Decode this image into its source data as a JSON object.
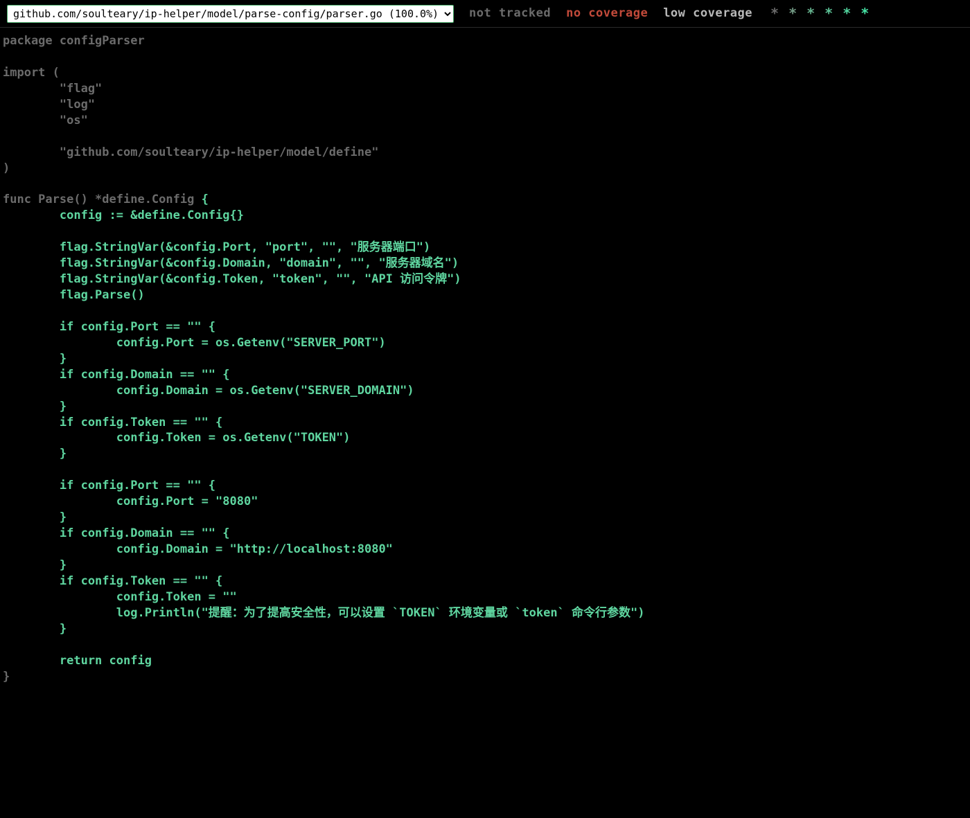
{
  "header": {
    "file_select_value": "github.com/soulteary/ip-helper/model/parse-config/parser.go (100.0%)",
    "legend": {
      "not_tracked": "not tracked",
      "no_coverage": "no coverage",
      "low_coverage": "low coverage"
    },
    "stars": [
      "*",
      "*",
      "*",
      "*",
      "*",
      "*"
    ],
    "star_colors": [
      "#6a6a6a",
      "#739a85",
      "#66b28e",
      "#5cc296",
      "#51d39d",
      "#46e3a5"
    ]
  },
  "code": {
    "lines": [
      {
        "c": "nc",
        "t": "package configParser"
      },
      {
        "c": "nc",
        "t": ""
      },
      {
        "c": "nc",
        "t": "import ("
      },
      {
        "c": "nc",
        "t": "        \"flag\""
      },
      {
        "c": "nc",
        "t": "        \"log\""
      },
      {
        "c": "nc",
        "t": "        \"os\""
      },
      {
        "c": "nc",
        "t": ""
      },
      {
        "c": "nc",
        "t": "        \"github.com/soulteary/ip-helper/model/define\""
      },
      {
        "c": "nc",
        "t": ")"
      },
      {
        "c": "nc",
        "t": ""
      },
      {
        "c": "mix",
        "parts": [
          {
            "c": "nc",
            "t": "func Parse() *define.Config "
          },
          {
            "c": "cv",
            "t": "{"
          }
        ]
      },
      {
        "c": "cv",
        "t": "        config := &define.Config{}"
      },
      {
        "c": "cv",
        "t": ""
      },
      {
        "c": "cv",
        "t": "        flag.StringVar(&config.Port, \"port\", \"\", \"服务器端口\")"
      },
      {
        "c": "cv",
        "t": "        flag.StringVar(&config.Domain, \"domain\", \"\", \"服务器域名\")"
      },
      {
        "c": "cv",
        "t": "        flag.StringVar(&config.Token, \"token\", \"\", \"API 访问令牌\")"
      },
      {
        "c": "cv",
        "t": "        flag.Parse()"
      },
      {
        "c": "cv",
        "t": ""
      },
      {
        "c": "cv",
        "t": "        if config.Port == \"\" {"
      },
      {
        "c": "cv",
        "t": "                config.Port = os.Getenv(\"SERVER_PORT\")"
      },
      {
        "c": "cv",
        "t": "        }"
      },
      {
        "c": "cv",
        "t": "        if config.Domain == \"\" {"
      },
      {
        "c": "cv",
        "t": "                config.Domain = os.Getenv(\"SERVER_DOMAIN\")"
      },
      {
        "c": "cv",
        "t": "        }"
      },
      {
        "c": "cv",
        "t": "        if config.Token == \"\" {"
      },
      {
        "c": "cv",
        "t": "                config.Token = os.Getenv(\"TOKEN\")"
      },
      {
        "c": "cv",
        "t": "        }"
      },
      {
        "c": "cv",
        "t": ""
      },
      {
        "c": "cv",
        "t": "        if config.Port == \"\" {"
      },
      {
        "c": "cv",
        "t": "                config.Port = \"8080\""
      },
      {
        "c": "cv",
        "t": "        }"
      },
      {
        "c": "cv",
        "t": "        if config.Domain == \"\" {"
      },
      {
        "c": "cv",
        "t": "                config.Domain = \"http://localhost:8080\""
      },
      {
        "c": "cv",
        "t": "        }"
      },
      {
        "c": "cv",
        "t": "        if config.Token == \"\" {"
      },
      {
        "c": "cv",
        "t": "                config.Token = \"\""
      },
      {
        "c": "cv",
        "t": "                log.Println(\"提醒：为了提高安全性，可以设置 `TOKEN` 环境变量或 `token` 命令行参数\")"
      },
      {
        "c": "cv",
        "t": "        }"
      },
      {
        "c": "cv",
        "t": ""
      },
      {
        "c": "cv",
        "t": "        return config"
      },
      {
        "c": "nc",
        "t": "}"
      }
    ]
  }
}
